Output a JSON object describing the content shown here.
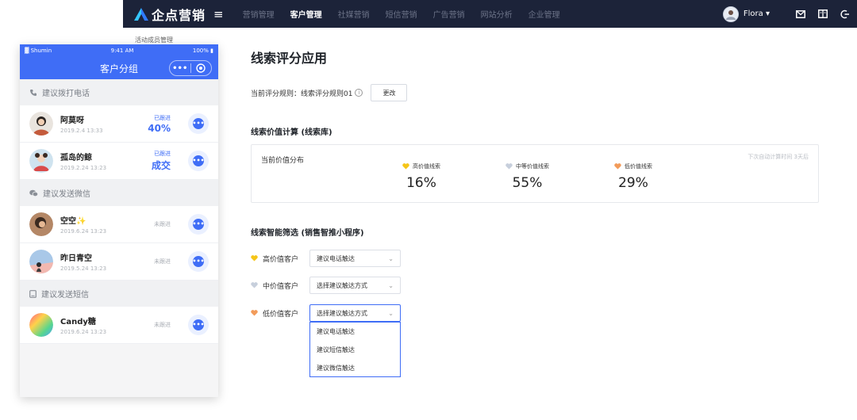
{
  "colors": {
    "nav_bg": "#1c2339",
    "accent": "#3f6df6",
    "high": "#f5c518",
    "mid": "#c7cfdc",
    "low": "#f29b5a"
  },
  "topbar": {
    "brand": "企点营销",
    "menu_icon": "hamburger-icon",
    "nav": [
      "营销管理",
      "客户管理",
      "社媒营销",
      "短信营销",
      "广告营销",
      "网站分析",
      "企业管理"
    ],
    "active_nav": "客户管理",
    "user": "Flora",
    "tools": [
      "mail-icon",
      "book-icon",
      "logout-icon"
    ]
  },
  "phone": {
    "caption": "活动成员管理",
    "status": {
      "carrier": "Shumin",
      "time": "9:41 AM",
      "battery": "100%"
    },
    "title": "客户分组",
    "capsule_more": "•••",
    "sections": [
      {
        "title": "建议拨打电话",
        "icon": "phone-icon"
      },
      {
        "title": "建议发送微信",
        "icon": "wechat-icon"
      },
      {
        "title": "建议发送短信",
        "icon": "sms-icon"
      }
    ],
    "contacts": [
      {
        "name": "阿莫呀",
        "date": "2019.2.4 13:33",
        "status": "已跟进",
        "value": "40%"
      },
      {
        "name": "孤岛的鲸",
        "date": "2019.2.24 13:23",
        "status": "已跟进",
        "value": "成交"
      },
      {
        "name": "空空✨",
        "date": "2019.6.24 13:23",
        "status": "未跟进",
        "value": ""
      },
      {
        "name": "昨日青空",
        "date": "2019.5.24 13:23",
        "status": "未跟进",
        "value": ""
      },
      {
        "name": "Candy糖",
        "date": "2019.6.24 13:23",
        "status": "未跟进",
        "value": ""
      }
    ],
    "chat_glyph": "•••"
  },
  "main": {
    "title": "线索评分应用",
    "rule_label": "当前评分规则：线索评分规则01",
    "info_glyph": "i",
    "change_button": "更改",
    "value_section_title": "线索价值计算 (线索库)",
    "distribution_label": "当前价值分布",
    "next_calc": "下次自动计算时间 3天后",
    "stats": [
      {
        "label": "高价值线索",
        "value": "16%"
      },
      {
        "label": "中等价值线索",
        "value": "55%"
      },
      {
        "label": "低价值线索",
        "value": "29%"
      }
    ],
    "filter_section_title": "线索智能筛选 (销售智推小程序)",
    "filters": [
      {
        "label": "高价值客户",
        "selected": "建议电话触达"
      },
      {
        "label": "中价值客户",
        "selected": "选择建议触达方式"
      },
      {
        "label": "低价值客户",
        "selected": "选择建议触达方式"
      }
    ],
    "dropdown_options": [
      "建议电话触达",
      "建议短信触达",
      "建议微信触达"
    ]
  }
}
